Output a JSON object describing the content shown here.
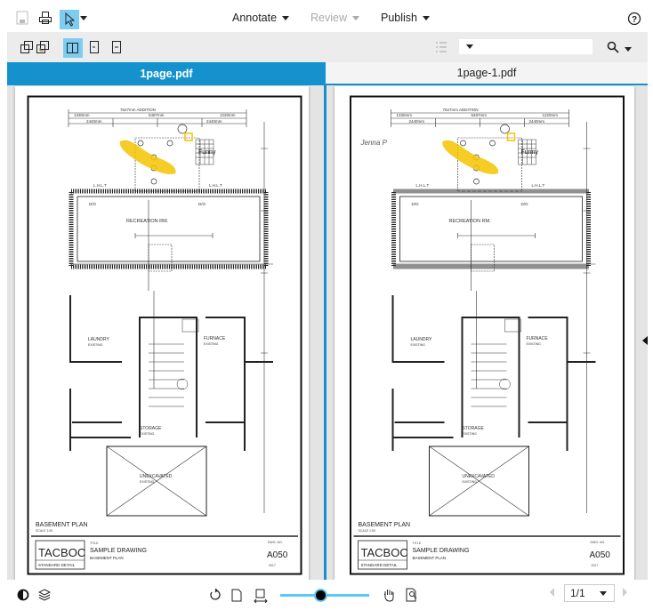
{
  "toolbar": {
    "save_icon": "save-icon",
    "print_icon": "print-icon",
    "select_icon": "cursor-arrow-icon",
    "menus": [
      {
        "label": "Annotate",
        "enabled": true
      },
      {
        "label": "Review",
        "enabled": false
      },
      {
        "label": "Publish",
        "enabled": true
      }
    ],
    "help_icon": "help-circle-icon"
  },
  "compare_toolbar": {
    "icons": [
      "overlay-icon",
      "overlay-diff-icon",
      "side-by-side-icon",
      "single-page-left-icon",
      "single-page-right-icon"
    ],
    "active": "side-by-side-icon",
    "list_icon": "list-icon",
    "dropdown_value": "",
    "search_icon": "search-icon"
  },
  "tabs": [
    {
      "label": "1page.pdf",
      "active": true
    },
    {
      "label": "1page-1.pdf",
      "active": false
    }
  ],
  "drawing": {
    "dim_top": "7627mm ADDITION",
    "dim_mid": "5487mm",
    "dim_left": "1330mm",
    "dim_right": "1220mm",
    "dim_a": "2440mm",
    "dim_b": "2440mm",
    "room_rec": "RECREATION RM.",
    "room_laundry": "LAUNDRY",
    "room_laundry_sub": "EXISTING",
    "room_furnace": "FURNACE",
    "room_furnace_sub": "EXISTING",
    "room_storage": "STORAGE",
    "room_storage_sub": "EXISTING",
    "room_unexc": "UNEXCAVATED",
    "room_unexc_sub": "EXISTING",
    "lhlt_left": "L.H.L.T",
    "lhlt_right": "L.H.L.T",
    "dio_left": "D/O",
    "dio_right": "D/O",
    "plan_title": "BASEMENT PLAN",
    "scale": "SCALE 1:50",
    "logo": "TACBOC",
    "logo_sub": "STANDARD DETAIL",
    "title_label": "TITLE",
    "title": "SAMPLE DRAWING",
    "subtitle": "BASEMENT PLAN",
    "dwg_label": "DWG. NO.",
    "dwg_no": "A050",
    "year": "2017",
    "note_label": "Funny",
    "highlight_color": "#f5c400",
    "signature": "Jenna P"
  },
  "bottom": {
    "contrast_icon": "contrast-icon",
    "layers_icon": "layers-icon",
    "rotate_icon": "rotate-icon",
    "fit_page_icon": "fit-page-icon",
    "fit_width_icon": "fit-width-icon",
    "zoom_level": 0.45,
    "pan_icon": "hand-icon",
    "zoom_area_icon": "zoom-area-icon",
    "page_select": "1/1",
    "accent": "#5bc8f5"
  },
  "colors": {
    "accent": "#1591cd",
    "active_button": "#7dcdf2"
  }
}
